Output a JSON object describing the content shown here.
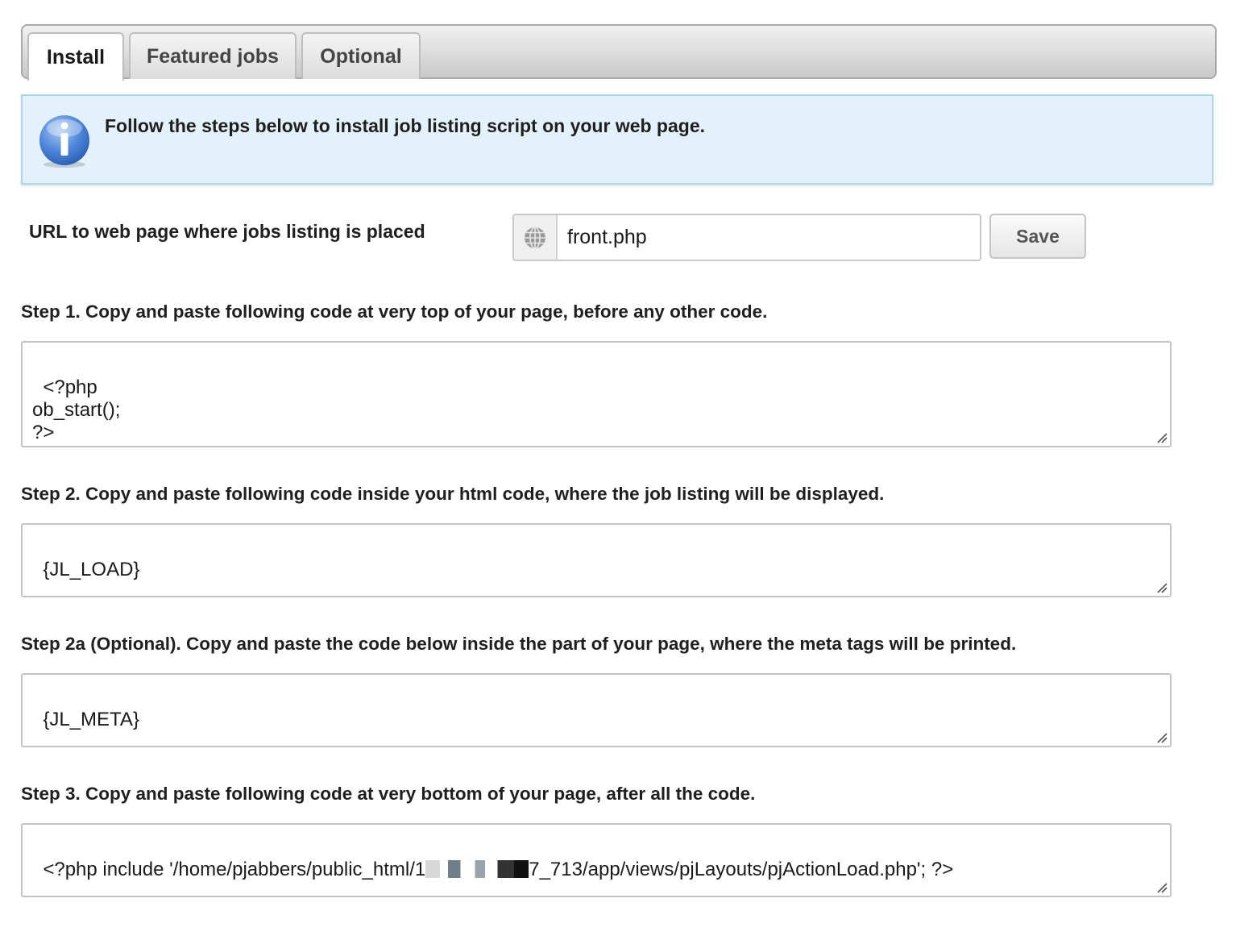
{
  "tabs": [
    {
      "label": "Install",
      "active": true
    },
    {
      "label": "Featured jobs",
      "active": false
    },
    {
      "label": "Optional",
      "active": false
    }
  ],
  "info": {
    "icon": "info-icon",
    "text": "Follow the steps below to install job listing script on your web page."
  },
  "url_setting": {
    "label": "URL to web page where jobs listing is placed",
    "icon": "globe-icon",
    "value": "front.php",
    "save_label": "Save"
  },
  "steps": [
    {
      "label": "Step 1. Copy and paste following code at very top of your page, before any other code.",
      "code": "<?php\nob_start();\n?>"
    },
    {
      "label": "Step 2. Copy and paste following code inside your html code, where the job listing will be displayed.",
      "code": "{JL_LOAD}"
    },
    {
      "label": "Step 2a (Optional). Copy and paste the code below inside the part of your page, where the meta tags will be printed.",
      "code": "{JL_META}"
    },
    {
      "label": "Step 3. Copy and paste following code at very bottom of your page, after all the code.",
      "code_prefix": "<?php include '/home/pjabbers/public_html/1",
      "code_suffix": "7_713/app/views/pjLayouts/pjActionLoad.php'; ?>"
    }
  ],
  "colors": {
    "info_background": "#e3f2fa",
    "info_border": "#a9d8ec",
    "tab_bar": "#c9c9c9"
  }
}
